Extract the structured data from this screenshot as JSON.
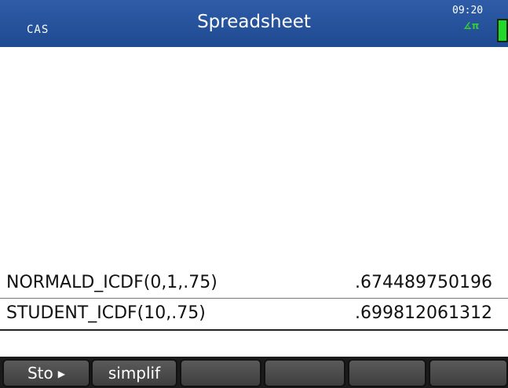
{
  "header": {
    "mode": "CAS",
    "title": "Spreadsheet",
    "time": "09:20",
    "angle_indicator": "∡π"
  },
  "history": [
    {
      "expression": "NORMALD_ICDF(0,1,.75)",
      "result": ".674489750196"
    },
    {
      "expression": "STUDENT_ICDF(10,.75)",
      "result": ".699812061312"
    }
  ],
  "softkeys": [
    {
      "label": "Sto",
      "icon": "right-triangle-icon"
    },
    {
      "label": "simplif"
    },
    {
      "label": ""
    },
    {
      "label": ""
    },
    {
      "label": ""
    },
    {
      "label": ""
    }
  ],
  "colors": {
    "titlebar": "#2a57a3",
    "softkey_bg": "#4a4a4a",
    "battery": "#25d62b"
  }
}
